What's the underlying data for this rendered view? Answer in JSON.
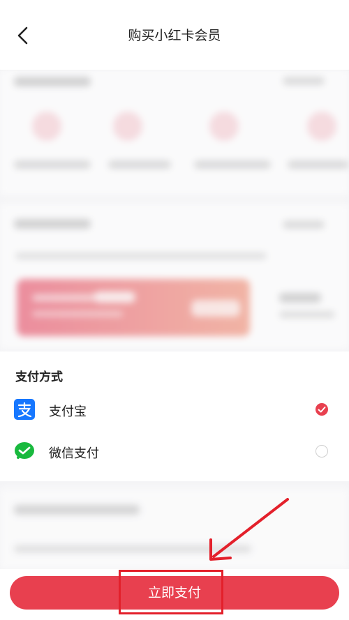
{
  "header": {
    "title": "购买小红卡会员"
  },
  "payment": {
    "section_title": "支付方式",
    "options": [
      {
        "label": "支付宝",
        "icon": "alipay-icon",
        "selected": true
      },
      {
        "label": "微信支付",
        "icon": "wechat-pay-icon",
        "selected": false
      }
    ]
  },
  "bottom": {
    "pay_label": "立即支付"
  },
  "colors": {
    "accent": "#e8404f",
    "alipay": "#1677ff",
    "wechat": "#19b93e",
    "annotation": "#e3202b"
  }
}
